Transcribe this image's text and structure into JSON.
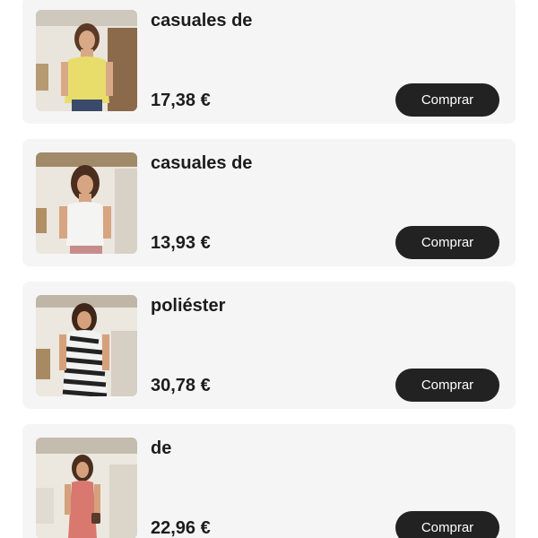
{
  "products": [
    {
      "title": "casuales de",
      "price": "17,38 €",
      "buy_label": "Comprar",
      "image": "woman-yellow-top-photo",
      "garment_color": "#e8dd6a"
    },
    {
      "title": "casuales de",
      "price": "13,93 €",
      "buy_label": "Comprar",
      "image": "woman-white-top-photo",
      "garment_color": "#f4f4f2"
    },
    {
      "title": "poliéster",
      "price": "30,78 €",
      "buy_label": "Comprar",
      "image": "woman-zebra-dress-photo",
      "garment_color": "#2a2a2a"
    },
    {
      "title": "de",
      "price": "22,96 €",
      "buy_label": "Comprar",
      "image": "woman-coral-dress-photo",
      "garment_color": "#d9786e"
    }
  ]
}
